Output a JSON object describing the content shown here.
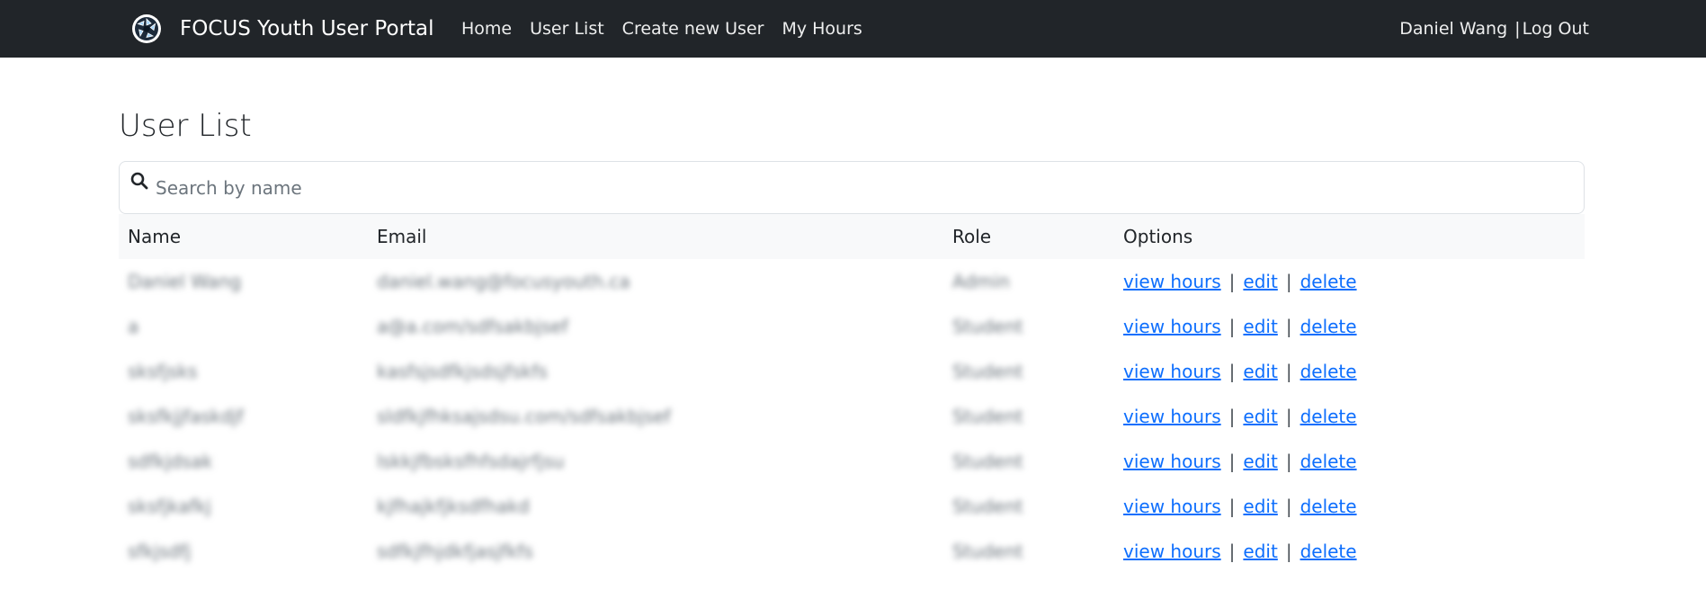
{
  "navbar": {
    "brand": "FOCUS Youth User Portal",
    "links": [
      "Home",
      "User List",
      "Create new User",
      "My Hours"
    ],
    "user_name": "Daniel Wang",
    "separator": "|",
    "logout_label": "Log Out"
  },
  "main": {
    "title": "User List",
    "search": {
      "placeholder": "Search by name",
      "value": ""
    },
    "table": {
      "headers": [
        "Name",
        "Email",
        "Role",
        "Options"
      ],
      "option_labels": {
        "view_hours": "view hours",
        "edit": "edit",
        "delete": "delete",
        "separator": "|"
      },
      "rows": [
        {
          "name": "Daniel Wang",
          "email": "daniel.wang@focusyouth.ca",
          "role": "Admin"
        },
        {
          "name": "a",
          "email": "a@a.com/sdfsakbjsef",
          "role": "Student"
        },
        {
          "name": "sksfjsks",
          "email": "kasfsjsdfkjsdsjfskfs",
          "role": "Student"
        },
        {
          "name": "sksfkjjfaskdjf",
          "email": "sldfkjfhksajsdsu.com/sdfsakbjsef",
          "role": "Student"
        },
        {
          "name": "sdfkjdsak",
          "email": "lskkjfbsksfhfsdajrfjsu",
          "role": "Student"
        },
        {
          "name": "sksfjkafkj",
          "email": "kjfhajkfjksdfhakd",
          "role": "Student"
        },
        {
          "name": "sfkjsdfj",
          "email": "sdfkjfhjdkfjasjfkfs",
          "role": "Student"
        }
      ]
    }
  },
  "colors": {
    "navbar_bg": "#212529",
    "link": "#0d6efd",
    "header_row_bg": "#f8f9fa"
  },
  "icons": {
    "brand": "focus-aperture-logo-icon",
    "search": "search-icon"
  }
}
